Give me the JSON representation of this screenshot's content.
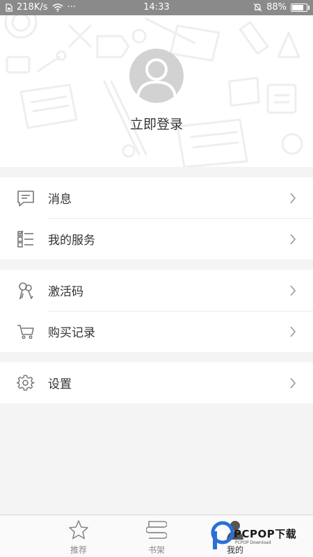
{
  "status_bar": {
    "speed": "218K/s",
    "dots": "···",
    "time": "14:33",
    "battery": "88%",
    "battery_level": 0.88
  },
  "header": {
    "login_text": "立即登录"
  },
  "menu": {
    "groups": [
      {
        "items": [
          {
            "label": "消息",
            "icon": "message-icon"
          },
          {
            "label": "我的服务",
            "icon": "checklist-icon"
          }
        ]
      },
      {
        "items": [
          {
            "label": "激活码",
            "icon": "keys-icon"
          },
          {
            "label": "购买记录",
            "icon": "cart-icon"
          }
        ]
      },
      {
        "items": [
          {
            "label": "设置",
            "icon": "gear-icon"
          }
        ]
      }
    ]
  },
  "bottom_nav": {
    "tabs": [
      {
        "label": "推荐",
        "icon": "star-icon"
      },
      {
        "label": "书架",
        "icon": "books-icon"
      },
      {
        "label": "我的",
        "icon": "person-icon",
        "active": true
      }
    ]
  },
  "watermark": {
    "text": "PCPOP下载",
    "sub": "PCPOP Download"
  },
  "colors": {
    "status_bar": "#8a8a8a",
    "background": "#f4f4f4",
    "row": "#ffffff",
    "text": "#333333",
    "muted": "#888888",
    "watermark_blue": "#2a6fd6"
  }
}
